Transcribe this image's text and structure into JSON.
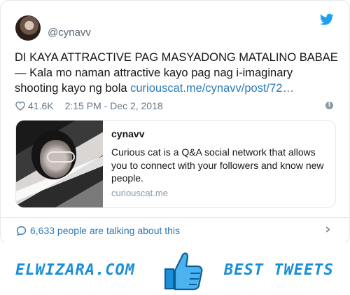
{
  "tweet": {
    "handle": "@cynavv",
    "text_main": "DI KAYA ATTRACTIVE PAG MASYADONG MATALINO BABAE — Kala mo naman attractive kayo pag nag i-imaginary shooting kayo ng bola ",
    "text_link": "curiouscat.me/cynavv/post/72…",
    "likes": "41.6K",
    "timestamp": "2:15 PM - Dec 2, 2018",
    "info_glyph": "i"
  },
  "link_card": {
    "title": "cynavv",
    "description": "Curious cat is a Q&A social network that allows you to connect with your followers and know new people.",
    "domain": "curiouscat.me"
  },
  "footer": {
    "talking": "6,633 people are talking about this"
  },
  "banner": {
    "left_brand": "ELWIZARA.COM",
    "right_brand": "BEST TWEETS"
  },
  "colors": {
    "accent": "#2b7bb9",
    "twitter_blue": "#1da1f2",
    "brand_blue": "#1a8fd8",
    "muted": "#657786",
    "border": "#e1e8ed"
  },
  "icons": {
    "bird": "twitter-bird-icon",
    "heart": "heart-icon",
    "info": "info-icon",
    "comment": "comment-bubble-icon",
    "chevron": "chevron-right-icon",
    "thumbs_up": "thumbs-up-icon"
  }
}
